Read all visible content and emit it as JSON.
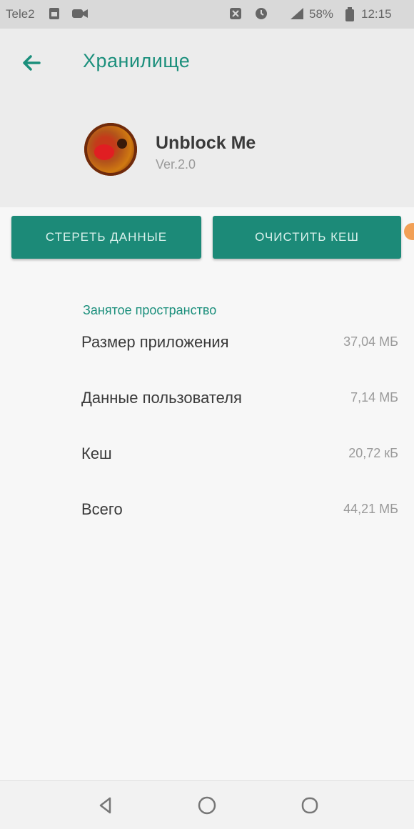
{
  "status_bar": {
    "carrier": "Tele2",
    "battery": "58%",
    "time": "12:15",
    "icons": [
      "sim-icon",
      "video-icon",
      "nfc-icon",
      "alarm-icon",
      "signal-icon",
      "battery-icon"
    ]
  },
  "header": {
    "back_icon": "arrow-left-icon",
    "title": "Хранилище",
    "app": {
      "name": "Unblock Me",
      "version": "Ver.2.0"
    }
  },
  "actions": {
    "clear_data": "СТЕРЕТЬ ДАННЫЕ",
    "clear_cache": "ОЧИСТИТЬ КЕШ"
  },
  "storage": {
    "section_title": "Занятое пространство",
    "rows": [
      {
        "label": "Размер приложения",
        "value": "37,04 МБ"
      },
      {
        "label": "Данные пользователя",
        "value": "7,14 МБ"
      },
      {
        "label": "Кеш",
        "value": "20,72 кБ"
      },
      {
        "label": "Всего",
        "value": "44,21 МБ"
      }
    ]
  },
  "nav_bar": {
    "back_icon": "nav-back-icon",
    "home_icon": "nav-home-icon",
    "recents_icon": "nav-recents-icon"
  },
  "colors": {
    "accent": "#1b8f7c",
    "button": "#1c8a78",
    "header_bg": "#ececec",
    "status_bar_bg": "#d9d9d9"
  }
}
